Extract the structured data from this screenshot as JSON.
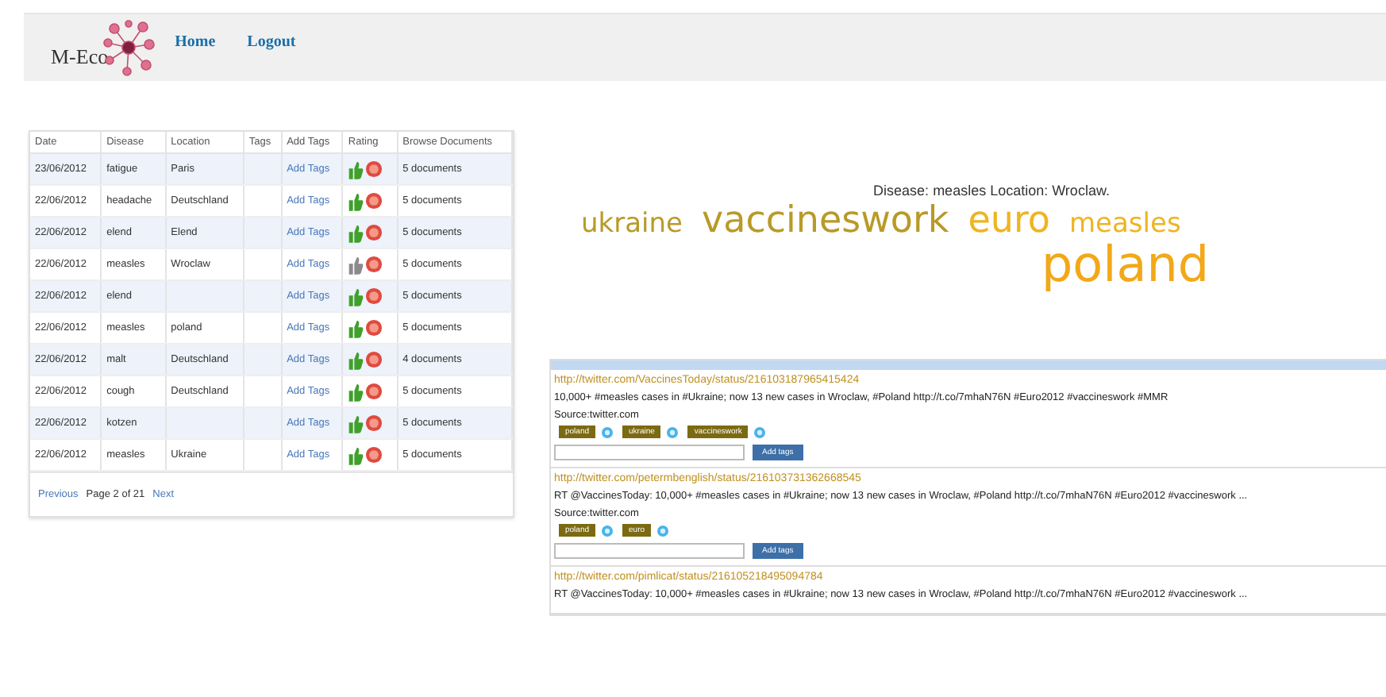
{
  "header": {
    "logo_text": "M-Eco",
    "nav": [
      "Home",
      "Logout"
    ]
  },
  "table": {
    "columns": [
      "Date",
      "Disease",
      "Location",
      "Tags",
      "Add Tags",
      "Rating",
      "Browse Documents"
    ],
    "rows": [
      {
        "date": "23/06/2012",
        "disease": "fatigue",
        "location": "Paris",
        "add_tags": "Add Tags",
        "thumb_active": true,
        "documents": "5 documents"
      },
      {
        "date": "22/06/2012",
        "disease": "headache",
        "location": "Deutschland",
        "add_tags": "Add Tags",
        "thumb_active": true,
        "documents": "5 documents"
      },
      {
        "date": "22/06/2012",
        "disease": "elend",
        "location": "Elend",
        "add_tags": "Add Tags",
        "thumb_active": true,
        "documents": "5 documents"
      },
      {
        "date": "22/06/2012",
        "disease": "measles",
        "location": "Wroclaw",
        "add_tags": "Add Tags",
        "thumb_active": false,
        "documents": "5 documents"
      },
      {
        "date": "22/06/2012",
        "disease": "elend",
        "location": "",
        "add_tags": "Add Tags",
        "thumb_active": true,
        "documents": "5 documents"
      },
      {
        "date": "22/06/2012",
        "disease": "measles",
        "location": "poland",
        "add_tags": "Add Tags",
        "thumb_active": true,
        "documents": "5 documents"
      },
      {
        "date": "22/06/2012",
        "disease": "malt",
        "location": "Deutschland",
        "add_tags": "Add Tags",
        "thumb_active": true,
        "documents": "4 documents"
      },
      {
        "date": "22/06/2012",
        "disease": "cough",
        "location": "Deutschland",
        "add_tags": "Add Tags",
        "thumb_active": true,
        "documents": "5 documents"
      },
      {
        "date": "22/06/2012",
        "disease": "kotzen",
        "location": "",
        "add_tags": "Add Tags",
        "thumb_active": true,
        "documents": "5 documents"
      },
      {
        "date": "22/06/2012",
        "disease": "measles",
        "location": "Ukraine",
        "add_tags": "Add Tags",
        "thumb_active": true,
        "documents": "5 documents"
      }
    ],
    "pager": {
      "previous": "Previous",
      "page": "Page 2 of 21",
      "next": "Next"
    }
  },
  "cloud": {
    "title": "Disease: measles Location: Wroclaw.",
    "words": [
      {
        "text": "ukraine",
        "kind": "medium",
        "color": "#b89a28"
      },
      {
        "text": "vaccineswork",
        "kind": "large",
        "color": "#b89a28"
      },
      {
        "text": "euro",
        "kind": "large",
        "color": "#eeb422"
      },
      {
        "text": "measles",
        "kind": "medium",
        "color": "#eeb422"
      },
      {
        "text": "poland",
        "kind": "huge",
        "color": "#f2a818"
      }
    ]
  },
  "feed": [
    {
      "url": "http://twitter.com/VaccinesToday/status/216103187965415424",
      "text": "10,000+ #measles cases in #Ukraine; now 13 new cases in Wroclaw, #Poland http://t.co/7mhaN76N #Euro2012 #vaccineswork #MMR",
      "source": "Source:twitter.com",
      "tags": [
        "poland",
        "ukraine",
        "vaccineswork"
      ],
      "button": "Add tags"
    },
    {
      "url": "http://twitter.com/petermbenglish/status/216103731362668545",
      "text": "RT @VaccinesToday: 10,000+ #measles cases in #Ukraine; now 13 new cases in Wroclaw, #Poland http://t.co/7mhaN76N #Euro2012 #vaccineswork ...",
      "source": "Source:twitter.com",
      "tags": [
        "poland",
        "euro"
      ],
      "button": "Add tags"
    },
    {
      "url": "http://twitter.com/pimlicat/status/216105218495094784",
      "text": "RT @VaccinesToday: 10,000+ #measles cases in #Ukraine; now 13 new cases in Wroclaw, #Poland http://t.co/7mhaN76N #Euro2012 #vaccineswork ..."
    }
  ]
}
